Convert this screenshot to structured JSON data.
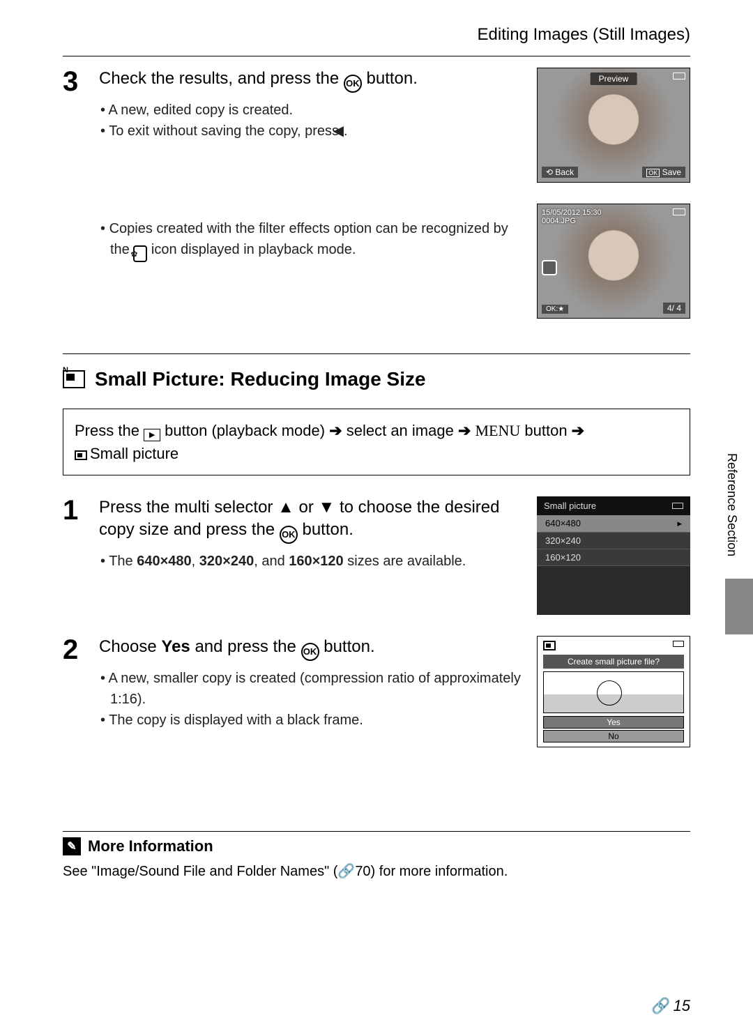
{
  "header": {
    "title": "Editing Images (Still Images)"
  },
  "step3": {
    "num": "3",
    "title_a": "Check the results, and press the ",
    "title_b": " button.",
    "b1": "A new, edited copy is created.",
    "b2_a": "To exit without saving the copy, press ",
    "b2_b": ".",
    "b3_a": "Copies created with the filter effects option can be recognized by the ",
    "b3_b": " icon displayed in playback mode."
  },
  "preview1": {
    "label": "Preview",
    "back": "Back",
    "save": "Save"
  },
  "preview2": {
    "ts1": "15/05/2012 15:30",
    "ts2": "0004.JPG",
    "bottom": "4/    4"
  },
  "section": {
    "heading": "Small Picture: Reducing Image Size"
  },
  "navbox": {
    "a": "Press the ",
    "b": " button (playback mode) ",
    "c": " select an image ",
    "d": " button ",
    "menu": "MENU",
    "sp": "Small picture",
    "arrow": "➔"
  },
  "step1": {
    "num": "1",
    "title_a": "Press the multi selector ",
    "title_b": " or ",
    "title_c": " to choose the desired copy size and press the ",
    "title_d": " button.",
    "b1_a": "The ",
    "b1_s1": "640×480",
    "b1_m": ", ",
    "b1_s2": "320×240",
    "b1_m2": ", and ",
    "b1_s3": "160×120",
    "b1_b": " sizes are available."
  },
  "menu": {
    "title": "Small picture",
    "r1": "640×480",
    "r2": "320×240",
    "r3": "160×120"
  },
  "step2": {
    "num": "2",
    "title_a": "Choose ",
    "title_yes": "Yes",
    "title_b": " and press the ",
    "title_c": " button.",
    "b1": "A new, smaller copy is created (compression ratio of approximately 1:16).",
    "b2": "The copy is displayed with a black frame."
  },
  "dialog": {
    "q": "Create small picture file?",
    "yes": "Yes",
    "no": "No"
  },
  "side": {
    "label": "Reference Section"
  },
  "moreinfo": {
    "h": "More Information",
    "text_a": "See \"Image/Sound File and Folder Names\" (",
    "text_b": "70) for more information."
  },
  "page": {
    "num": "15"
  }
}
